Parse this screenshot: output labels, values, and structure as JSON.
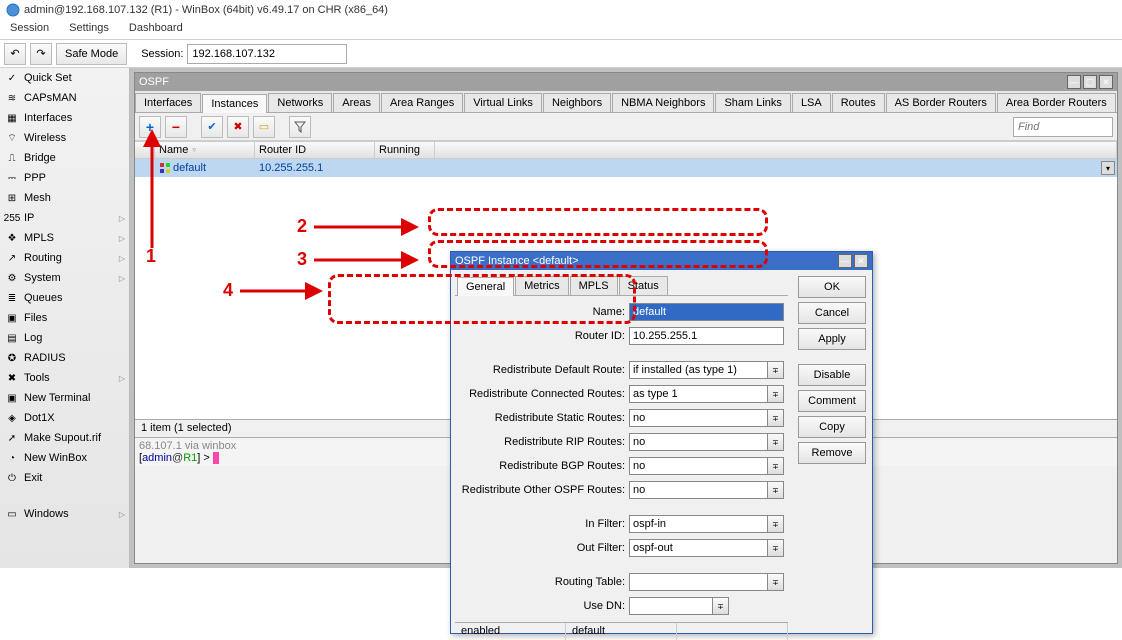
{
  "titlebar": "admin@192.168.107.132 (R1) - WinBox (64bit) v6.49.17 on CHR (x86_64)",
  "menu": {
    "session": "Session",
    "settings": "Settings",
    "dashboard": "Dashboard"
  },
  "toolbar": {
    "safe_mode": "Safe Mode",
    "session_label": "Session:",
    "session_value": "192.168.107.132"
  },
  "sidebar": [
    {
      "label": "Quick Set",
      "icon": "✓",
      "arrow": false
    },
    {
      "label": "CAPsMAN",
      "icon": "≋",
      "arrow": false
    },
    {
      "label": "Interfaces",
      "icon": "▦",
      "arrow": false
    },
    {
      "label": "Wireless",
      "icon": "⌔",
      "arrow": false
    },
    {
      "label": "Bridge",
      "icon": "⎍",
      "arrow": false
    },
    {
      "label": "PPP",
      "icon": "⎓",
      "arrow": false
    },
    {
      "label": "Mesh",
      "icon": "⊞",
      "arrow": false
    },
    {
      "label": "IP",
      "icon": "255",
      "arrow": true
    },
    {
      "label": "MPLS",
      "icon": "❖",
      "arrow": true
    },
    {
      "label": "Routing",
      "icon": "↗",
      "arrow": true
    },
    {
      "label": "System",
      "icon": "⚙",
      "arrow": true
    },
    {
      "label": "Queues",
      "icon": "≣",
      "arrow": false
    },
    {
      "label": "Files",
      "icon": "▣",
      "arrow": false
    },
    {
      "label": "Log",
      "icon": "▤",
      "arrow": false
    },
    {
      "label": "RADIUS",
      "icon": "✪",
      "arrow": false
    },
    {
      "label": "Tools",
      "icon": "✖",
      "arrow": true
    },
    {
      "label": "New Terminal",
      "icon": "▣",
      "arrow": false
    },
    {
      "label": "Dot1X",
      "icon": "◈",
      "arrow": false
    },
    {
      "label": "Make Supout.rif",
      "icon": "➚",
      "arrow": false
    },
    {
      "label": "New WinBox",
      "icon": "◔",
      "arrow": false
    },
    {
      "label": "Exit",
      "icon": "⏻",
      "arrow": false
    }
  ],
  "sidebar_bottom": {
    "label": "Windows",
    "icon": "▭",
    "arrow": true
  },
  "ospf": {
    "title": "OSPF",
    "tabs": [
      "Interfaces",
      "Instances",
      "Networks",
      "Areas",
      "Area Ranges",
      "Virtual Links",
      "Neighbors",
      "NBMA Neighbors",
      "Sham Links",
      "LSA",
      "Routes",
      "AS Border Routers",
      "Area Border Routers"
    ],
    "active_tab": 1,
    "find_placeholder": "Find",
    "columns": {
      "name": "Name",
      "router_id": "Router ID",
      "running": "Running"
    },
    "row": {
      "name": "default",
      "router_id": "10.255.255.1",
      "running": ""
    },
    "status": "1 item (1 selected)",
    "terminal_line1": "68.107.1 via winbox",
    "terminal_prompt": {
      "user": "admin",
      "host": "R1",
      "gt": ">"
    }
  },
  "instance": {
    "title": "OSPF Instance <default>",
    "tabs": [
      "General",
      "Metrics",
      "MPLS",
      "Status"
    ],
    "active_tab": 0,
    "buttons": {
      "ok": "OK",
      "cancel": "Cancel",
      "apply": "Apply",
      "disable": "Disable",
      "comment": "Comment",
      "copy": "Copy",
      "remove": "Remove"
    },
    "fields": {
      "name_label": "Name:",
      "name_value": "default",
      "router_id_label": "Router ID:",
      "router_id_value": "10.255.255.1",
      "redist_default_label": "Redistribute Default Route:",
      "redist_default_value": "if installed (as type 1)",
      "redist_connected_label": "Redistribute Connected Routes:",
      "redist_connected_value": "as type 1",
      "redist_static_label": "Redistribute Static Routes:",
      "redist_static_value": "no",
      "redist_rip_label": "Redistribute RIP Routes:",
      "redist_rip_value": "no",
      "redist_bgp_label": "Redistribute BGP Routes:",
      "redist_bgp_value": "no",
      "redist_other_label": "Redistribute Other OSPF Routes:",
      "redist_other_value": "no",
      "in_filter_label": "In Filter:",
      "in_filter_value": "ospf-in",
      "out_filter_label": "Out Filter:",
      "out_filter_value": "ospf-out",
      "routing_table_label": "Routing Table:",
      "routing_table_value": "",
      "use_dn_label": "Use DN:",
      "use_dn_value": ""
    },
    "status_enabled": "enabled",
    "status_default": "default"
  },
  "annotations": {
    "n1": "1",
    "n2": "2",
    "n3": "3",
    "n4": "4"
  }
}
